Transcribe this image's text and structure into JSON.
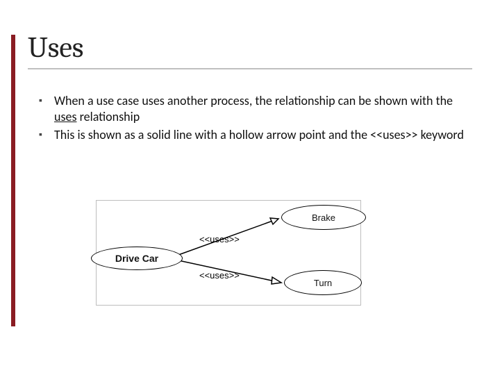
{
  "title": "Uses",
  "bullets": [
    {
      "prefix": "When a use case uses another process, the relationship can be shown with the ",
      "underlined": "uses",
      "suffix": " relationship"
    },
    {
      "full": "This is shown as a solid line with a hollow arrow point and the <<uses>> keyword"
    }
  ],
  "diagram": {
    "driveCar": "Drive Car",
    "brake": "Brake",
    "turn": "Turn",
    "stereotype": "<<uses>>"
  }
}
